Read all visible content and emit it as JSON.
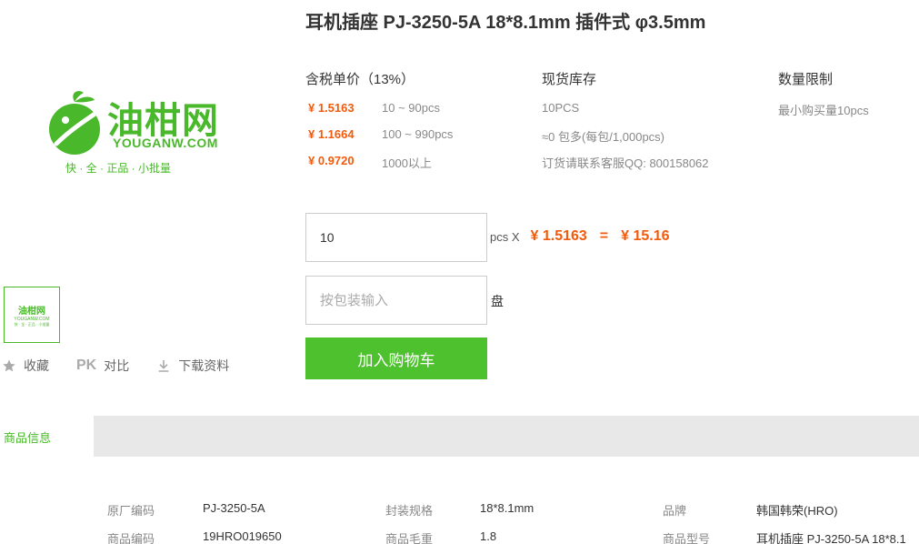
{
  "logo": {
    "name_cn": "油柑网",
    "name_en": "YOUGANW.COM",
    "slogan": "快 · 全 · 正品 · 小批量"
  },
  "product": {
    "title": "耳机插座 PJ-3250-5A 18*8.1mm 插件式 φ3.5mm"
  },
  "pricing": {
    "header": "含税单价（13%）",
    "tiers": [
      {
        "price": "¥ 1.5163",
        "range": "10 ~ 90pcs"
      },
      {
        "price": "¥ 1.1664",
        "range": "100 ~ 990pcs"
      },
      {
        "price": "¥ 0.9720",
        "range": "1000以上"
      }
    ]
  },
  "stock": {
    "header": "现货库存",
    "lines": [
      "10PCS",
      "≈0 包多(每包/1,000pcs)",
      "订货请联系客服QQ: 800158062"
    ]
  },
  "limit": {
    "header": "数量限制",
    "text": "最小购买量10pcs"
  },
  "order": {
    "qty_value": "10",
    "unit_label": "pcs X",
    "unit_price": "¥ 1.5163",
    "equals": "=",
    "total": "¥ 15.16",
    "package_placeholder": "按包装输入",
    "package_unit": "盘",
    "cart_button": "加入购物车"
  },
  "actions": {
    "collect": "收藏",
    "compare_icon": "PK",
    "compare": "对比",
    "download": "下载资料"
  },
  "tabs": {
    "info": "商品信息"
  },
  "details": [
    {
      "k1": "原厂编码",
      "v1": "PJ-3250-5A",
      "k2": "封装规格",
      "v2": "18*8.1mm",
      "k3": "品牌",
      "v3": "韩国韩荣(HRO)"
    },
    {
      "k1": "商品编码",
      "v1": "19HRO019650",
      "k2": "商品毛重",
      "v2": "1.8",
      "k3": "商品型号",
      "v3": "耳机插座 PJ-3250-5A 18*8.1"
    }
  ],
  "colors": {
    "brand_green": "#4ab82b",
    "price_orange": "#f25a0c"
  }
}
